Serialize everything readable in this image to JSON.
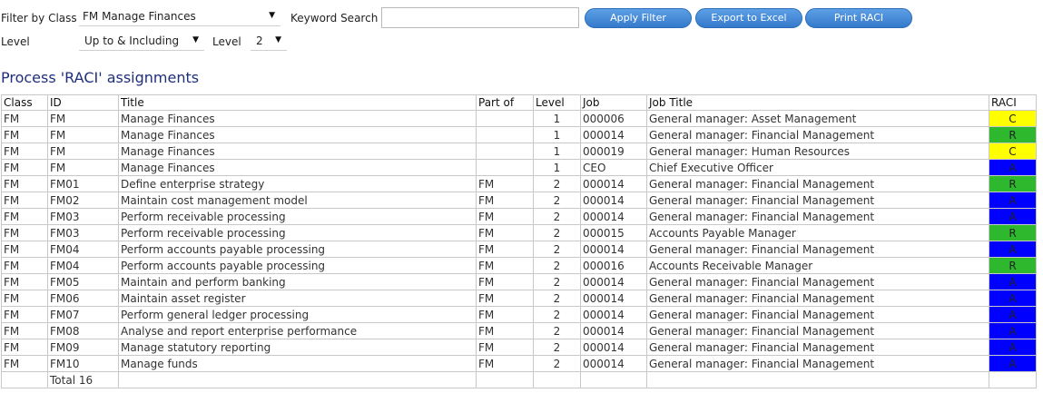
{
  "filters": {
    "class_label": "Filter by Class",
    "class_value": "FM Manage Finances",
    "keyword_label": "Keyword Search",
    "keyword_value": "",
    "level_label": "Level",
    "level_mode_value": "Up to & Including",
    "level2_label": "Level",
    "level_value": "2"
  },
  "buttons": {
    "apply": "Apply Filter",
    "export": "Export to Excel",
    "print": "Print RACI"
  },
  "section_title": "Process 'RACI' assignments",
  "colors": {
    "R": "#2eb82e",
    "A": "#0000ff",
    "C": "#ffff00"
  },
  "table": {
    "headers": [
      "Class",
      "ID",
      "Title",
      "Part of",
      "Level",
      "Job",
      "Job Title",
      "RACI"
    ],
    "rows": [
      [
        "FM",
        "FM",
        "Manage Finances",
        "",
        "1",
        "000006",
        "General manager: Asset Management",
        "C"
      ],
      [
        "FM",
        "FM",
        "Manage Finances",
        "",
        "1",
        "000014",
        "General manager: Financial Management",
        "R"
      ],
      [
        "FM",
        "FM",
        "Manage Finances",
        "",
        "1",
        "000019",
        "General manager: Human Resources",
        "C"
      ],
      [
        "FM",
        "FM",
        "Manage Finances",
        "",
        "1",
        "CEO",
        "Chief Executive Officer",
        "A"
      ],
      [
        "FM",
        "FM01",
        "Define enterprise strategy",
        "FM",
        "2",
        "000014",
        "General manager: Financial Management",
        "R"
      ],
      [
        "FM",
        "FM02",
        "Maintain cost management model",
        "FM",
        "2",
        "000014",
        "General manager: Financial Management",
        "A"
      ],
      [
        "FM",
        "FM03",
        "Perform receivable processing",
        "FM",
        "2",
        "000014",
        "General manager: Financial Management",
        "A"
      ],
      [
        "FM",
        "FM03",
        "Perform receivable processing",
        "FM",
        "2",
        "000015",
        "Accounts Payable Manager",
        "R"
      ],
      [
        "FM",
        "FM04",
        "Perform accounts payable processing",
        "FM",
        "2",
        "000014",
        "General manager: Financial Management",
        "A"
      ],
      [
        "FM",
        "FM04",
        "Perform accounts payable processing",
        "FM",
        "2",
        "000016",
        "Accounts Receivable Manager",
        "R"
      ],
      [
        "FM",
        "FM05",
        "Maintain and perform banking",
        "FM",
        "2",
        "000014",
        "General manager: Financial Management",
        "A"
      ],
      [
        "FM",
        "FM06",
        "Maintain asset register",
        "FM",
        "2",
        "000014",
        "General manager: Financial Management",
        "A"
      ],
      [
        "FM",
        "FM07",
        "Perform general ledger processing",
        "FM",
        "2",
        "000014",
        "General manager: Financial Management",
        "A"
      ],
      [
        "FM",
        "FM08",
        "Analyse and report enterprise performance",
        "FM",
        "2",
        "000014",
        "General manager: Financial Management",
        "A"
      ],
      [
        "FM",
        "FM09",
        "Manage statutory reporting",
        "FM",
        "2",
        "000014",
        "General manager: Financial Management",
        "A"
      ],
      [
        "FM",
        "FM10",
        "Manage funds",
        "FM",
        "2",
        "000014",
        "General manager: Financial Management",
        "A"
      ]
    ],
    "total_label": "Total 16"
  }
}
